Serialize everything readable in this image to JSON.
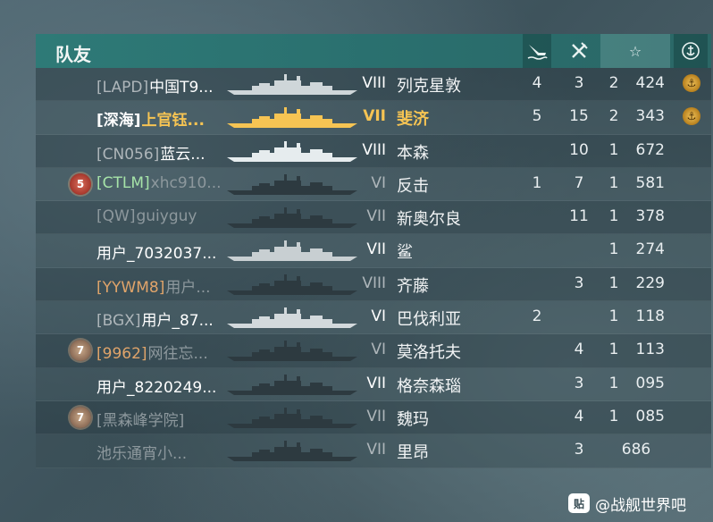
{
  "panel": {
    "title": "队友",
    "header_icons": {
      "kills": "ship-sinking-icon",
      "planes": "plane-shotdown-icon",
      "score": "star-icon",
      "medal": "anchor-medal-icon"
    }
  },
  "colors": {
    "header_bg": "#2e7a77",
    "gold": "#f6c453",
    "orange_clan": "#e0a46a",
    "green_clan": "#a6e3a8",
    "white": "#ffffff",
    "gray": "#aeb6ba",
    "dim": "#8d989d"
  },
  "rows": [
    {
      "badge": "",
      "clan": "[LAPD]",
      "name": "中国T9...",
      "tier": "VIII",
      "ship": "列克星敦",
      "kills": "4",
      "planes": "3",
      "rank": "2",
      "score": "424",
      "medal": true,
      "name_color": "white",
      "clan_color": "gray",
      "ship_color": "#cfd6d9"
    },
    {
      "badge": "",
      "clan": "[深海]",
      "name": "上官钰...",
      "tier": "VII",
      "ship": "斐济",
      "kills": "5",
      "planes": "15",
      "rank": "2",
      "score": "343",
      "medal": true,
      "name_color": "gold",
      "clan_color": "white-bold",
      "ship_color": "#f6c453"
    },
    {
      "badge": "",
      "clan": "[CN056]",
      "name": "蓝云...",
      "tier": "VIII",
      "ship": "本森",
      "kills": "",
      "planes": "10",
      "rank": "1",
      "score": "672",
      "medal": false,
      "name_color": "white",
      "clan_color": "gray",
      "ship_color": "#e6ecee"
    },
    {
      "badge": "5",
      "badge_style": "red",
      "clan": "[CTLM]",
      "name": "xhc910...",
      "tier": "VI",
      "ship": "反击",
      "kills": "1",
      "planes": "7",
      "rank": "1",
      "score": "581",
      "medal": false,
      "name_color": "dim",
      "clan_color": "green",
      "ship_color": "#2d3a40"
    },
    {
      "badge": "",
      "clan": "[QW]",
      "name": "guiyguy",
      "tier": "VII",
      "ship": "新奥尔良",
      "kills": "",
      "planes": "11",
      "rank": "1",
      "score": "378",
      "medal": false,
      "name_color": "dim",
      "clan_color": "dim",
      "ship_color": "#2d3a40"
    },
    {
      "badge": "",
      "clan": "",
      "name": "用户_7032037...",
      "tier": "VII",
      "ship": "鲨",
      "kills": "",
      "planes": "",
      "rank": "1",
      "score": "274",
      "medal": false,
      "name_color": "white",
      "clan_color": "gray",
      "ship_color": "#c8cfd2"
    },
    {
      "badge": "",
      "clan": "[YYWM8]",
      "name": "用户...",
      "tier": "VIII",
      "ship": "齐藤",
      "kills": "",
      "planes": "3",
      "rank": "1",
      "score": "229",
      "medal": false,
      "name_color": "dim",
      "clan_color": "orange",
      "ship_color": "#2d3a40"
    },
    {
      "badge": "",
      "clan": "[BGX]",
      "name": "用户_87...",
      "tier": "VI",
      "ship": "巴伐利亚",
      "kills": "2",
      "planes": "",
      "rank": "1",
      "score": "118",
      "medal": false,
      "name_color": "white",
      "clan_color": "gray",
      "ship_color": "#d3d9dc"
    },
    {
      "badge": "7",
      "badge_style": "tan",
      "clan": "[9962]",
      "name": "网往忘...",
      "tier": "VI",
      "ship": "莫洛托夫",
      "kills": "",
      "planes": "4",
      "rank": "1",
      "score": "113",
      "medal": false,
      "name_color": "dim",
      "clan_color": "orange",
      "ship_color": "#2d3a40"
    },
    {
      "badge": "",
      "clan": "",
      "name": "用户_8220249...",
      "tier": "VII",
      "ship": "格奈森瑙",
      "kills": "",
      "planes": "3",
      "rank": "1",
      "score": "095",
      "medal": false,
      "name_color": "white",
      "clan_color": "gray",
      "ship_color": "#2d3a40"
    },
    {
      "badge": "7",
      "badge_style": "tan",
      "clan": "[黑森峰学院]",
      "name": "",
      "tier": "VII",
      "ship": "魏玛",
      "kills": "",
      "planes": "4",
      "rank": "1",
      "score": "085",
      "medal": false,
      "name_color": "dim",
      "clan_color": "dim",
      "ship_color": "#2d3a40"
    },
    {
      "badge": "",
      "clan": "",
      "name": "池乐通宵小...",
      "tier": "VII",
      "ship": "里昂",
      "kills": "",
      "planes": "3",
      "rank": "",
      "score": "686",
      "medal": false,
      "name_color": "dim",
      "clan_color": "dim",
      "ship_color": "#2d3a40"
    }
  ],
  "watermark": {
    "icon": "tieba-paw-icon",
    "icon_text": "贴",
    "text": "@战舰世界吧"
  }
}
